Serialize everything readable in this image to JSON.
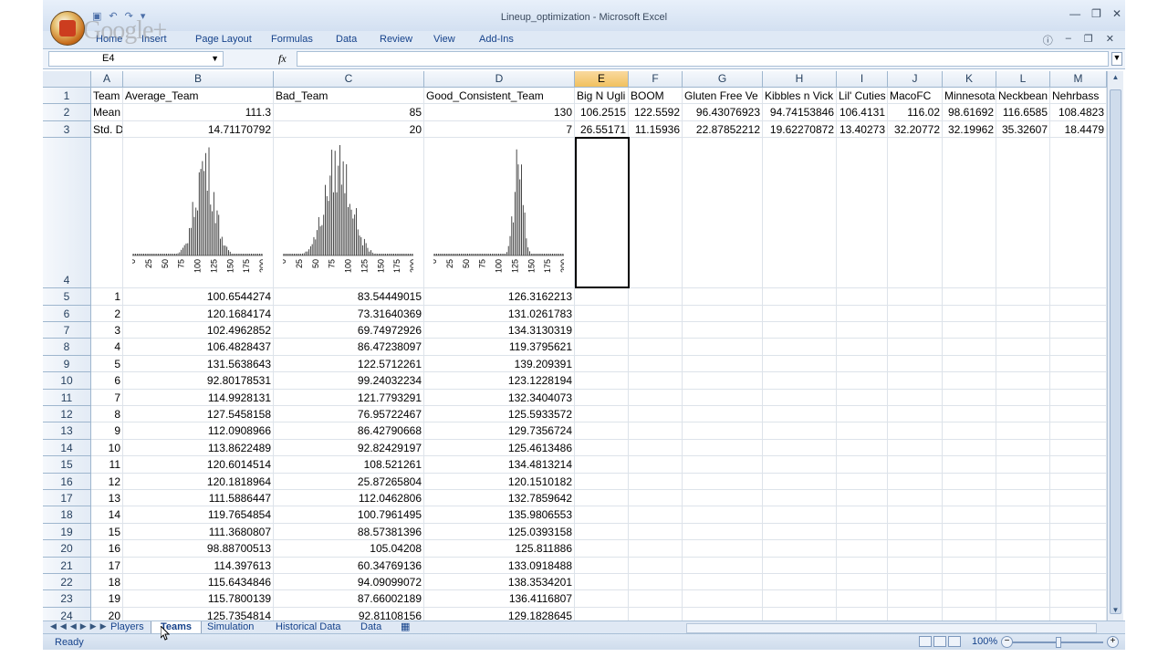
{
  "window": {
    "title": "Lineup_optimization - Microsoft Excel",
    "watermark": "Google+"
  },
  "ribbon": {
    "tabs": [
      "Home",
      "Insert",
      "Page Layout",
      "Formulas",
      "Data",
      "Review",
      "View",
      "Add-Ins"
    ]
  },
  "formula_bar": {
    "name_box": "E4",
    "fx_label": "fx",
    "formula": ""
  },
  "columns": [
    {
      "letter": "A"
    },
    {
      "letter": "B"
    },
    {
      "letter": "C"
    },
    {
      "letter": "D"
    },
    {
      "letter": "E"
    },
    {
      "letter": "F"
    },
    {
      "letter": "G"
    },
    {
      "letter": "H"
    },
    {
      "letter": "I"
    },
    {
      "letter": "J"
    },
    {
      "letter": "K"
    },
    {
      "letter": "L"
    },
    {
      "letter": "M"
    }
  ],
  "header_row": [
    "Team Nan",
    "Average_Team",
    "Bad_Team",
    "Good_Consistent_Team",
    "Big N Ugli",
    "BOOM",
    "Gluten Free Ve",
    "Kibbles n Vick",
    "Lil' Cuties",
    "MacoFC",
    "Minnesota",
    "Neckbean",
    "Nehrbass"
  ],
  "mean_row": [
    "Mean",
    "111.3",
    "85",
    "130",
    "106.2515",
    "122.5592",
    "96.43076923",
    "94.74153846",
    "106.4131",
    "116.02",
    "98.61692",
    "116.6585",
    "108.4823"
  ],
  "std_row": [
    "Std. Dev",
    "14.71170792",
    "20",
    "7",
    "26.55171",
    "11.15936",
    "22.87852212",
    "19.62270872",
    "13.40273",
    "32.20772",
    "32.19962",
    "35.32607",
    "18.4479"
  ],
  "chart_axis_labels": [
    "0",
    "25",
    "50",
    "75",
    "100",
    "125",
    "150",
    "175",
    "200"
  ],
  "data_rows": [
    [
      "1",
      "100.6544274",
      "83.54449015",
      "126.3162213"
    ],
    [
      "2",
      "120.1684174",
      "73.31640369",
      "131.0261783"
    ],
    [
      "3",
      "102.4962852",
      "69.74972926",
      "134.3130319"
    ],
    [
      "4",
      "106.4828437",
      "86.47238097",
      "119.3795621"
    ],
    [
      "5",
      "131.5638643",
      "122.5712261",
      "139.209391"
    ],
    [
      "6",
      "92.80178531",
      "99.24032234",
      "123.1228194"
    ],
    [
      "7",
      "114.9928131",
      "121.7793291",
      "132.3404073"
    ],
    [
      "8",
      "127.5458158",
      "76.95722467",
      "125.5933572"
    ],
    [
      "9",
      "112.0908966",
      "86.42790668",
      "129.7356724"
    ],
    [
      "10",
      "113.8622489",
      "92.82429197",
      "125.4613486"
    ],
    [
      "11",
      "120.6014514",
      "108.521261",
      "134.4813214"
    ],
    [
      "12",
      "120.1818964",
      "25.87265804",
      "120.1510182"
    ],
    [
      "13",
      "111.5886447",
      "112.0462806",
      "132.7859642"
    ],
    [
      "14",
      "119.7654854",
      "100.7961495",
      "135.9806553"
    ],
    [
      "15",
      "111.3680807",
      "88.57381396",
      "125.0393158"
    ],
    [
      "16",
      "98.88700513",
      "105.04208",
      "125.811886"
    ],
    [
      "17",
      "114.397613",
      "60.34769136",
      "133.0918488"
    ],
    [
      "18",
      "115.6434846",
      "94.09099072",
      "138.3534201"
    ],
    [
      "19",
      "115.7800139",
      "87.66002189",
      "136.4116807"
    ],
    [
      "20",
      "125.7354814",
      "92.81108156",
      "129.1828645"
    ]
  ],
  "sheet_tabs": [
    "Players",
    "Teams",
    "Simulation",
    "Historical Data",
    "Data"
  ],
  "active_sheet": "Teams",
  "status": {
    "ready": "Ready",
    "zoom": "100%"
  }
}
